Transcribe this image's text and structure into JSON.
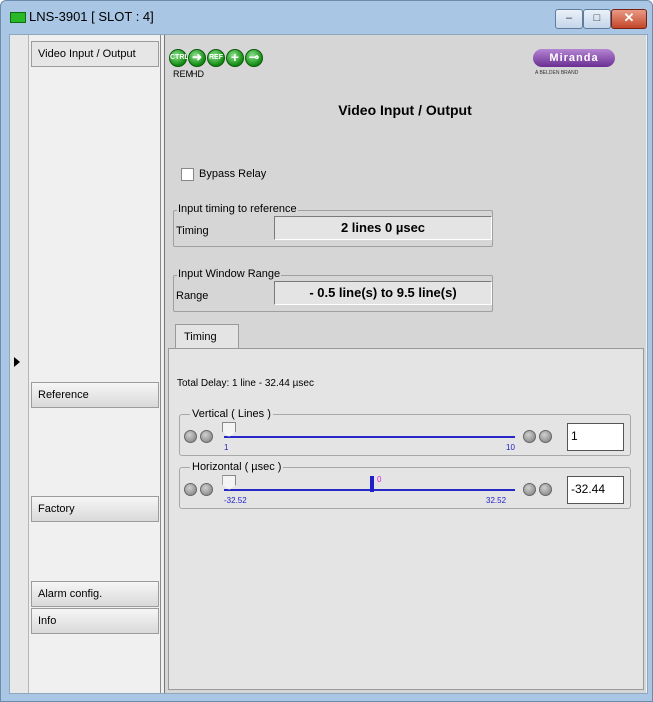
{
  "window": {
    "title": "LNS-3901 [ SLOT : 4]",
    "min_label": "–",
    "max_label": "□",
    "close_label": "✕"
  },
  "nav": {
    "items": [
      {
        "label": "Video Input / Output"
      },
      {
        "label": "Reference"
      },
      {
        "label": "Factory"
      },
      {
        "label": "Alarm config."
      },
      {
        "label": "Info"
      }
    ]
  },
  "status": {
    "icons": [
      "ctrl-icon",
      "arrow-right-icon",
      "ref-icon",
      "plus-icon",
      "link-icon"
    ],
    "ctrl_text": "CTRL",
    "ref_text": "REF",
    "rem": "REM",
    "hd": "HD"
  },
  "brand": {
    "logo": "Miranda",
    "sub": "A BELDEN BRAND"
  },
  "page": {
    "title": "Video Input / Output",
    "bypass_label": "Bypass Relay",
    "bypass_checked": false,
    "timing_group": {
      "title": "Input timing to reference",
      "label": "Timing",
      "value": "2 lines 0 µsec"
    },
    "window_group": {
      "title": "Input Window Range",
      "label": "Range",
      "value": "- 0.5 line(s) to  9.5 line(s)"
    }
  },
  "tabs": [
    {
      "label": "Timing"
    }
  ],
  "timing_tab": {
    "total_delay": "Total Delay:  1 line  - 32.44 µsec",
    "vertical": {
      "title": "Vertical ( Lines )",
      "min": "1",
      "max": "10",
      "value": "1",
      "fraction": 0.0
    },
    "horizontal": {
      "title": "Horizontal ( µsec )",
      "min": "-32.52",
      "max": "32.52",
      "center": "0",
      "value": "-32.44",
      "fraction": 0.001
    }
  }
}
